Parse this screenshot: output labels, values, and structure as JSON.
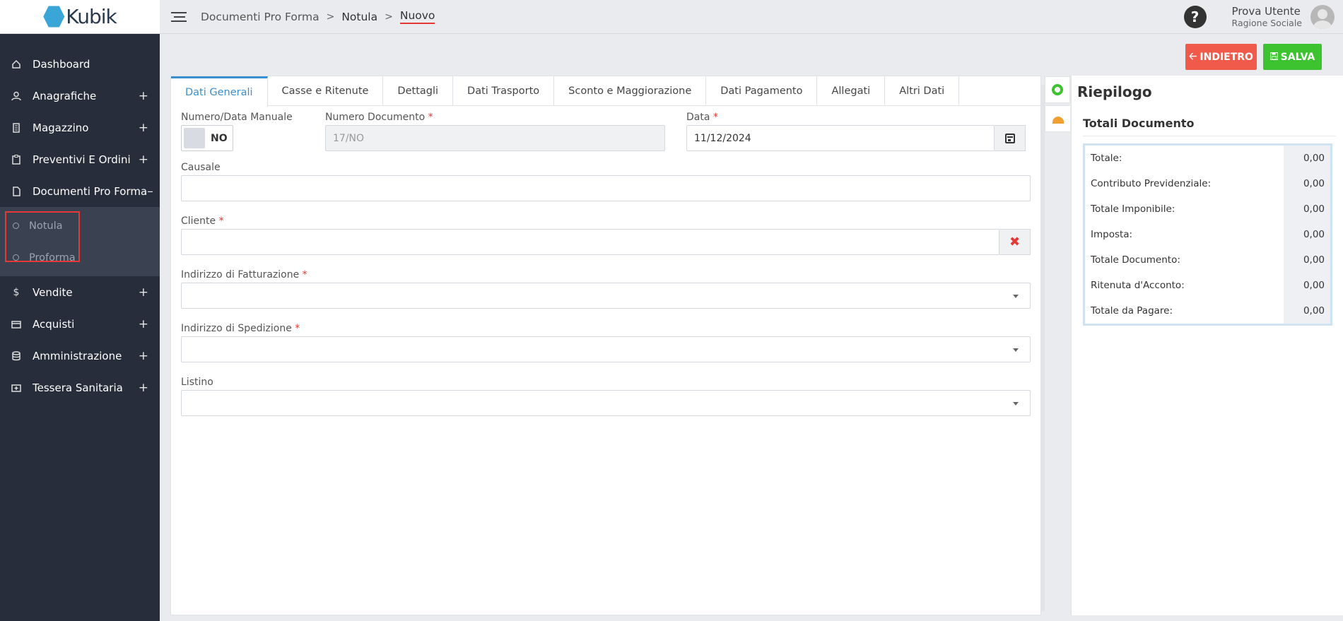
{
  "brand": {
    "name": "Kubik"
  },
  "sidebar": {
    "items": [
      {
        "label": "Dashboard",
        "icon": "home-icon",
        "expandable": false
      },
      {
        "label": "Anagrafiche",
        "icon": "user-icon",
        "expandable": true,
        "toggle": "+"
      },
      {
        "label": "Magazzino",
        "icon": "building-icon",
        "expandable": true,
        "toggle": "+"
      },
      {
        "label": "Preventivi E Ordini",
        "icon": "clipboard-icon",
        "expandable": true,
        "toggle": "+"
      },
      {
        "label": "Documenti Pro Forma",
        "icon": "document-icon",
        "expandable": true,
        "toggle": "–"
      }
    ],
    "subitems": [
      {
        "label": "Notula"
      },
      {
        "label": "Proforma"
      }
    ],
    "items_after": [
      {
        "label": "Vendite",
        "icon": "dollar-icon",
        "toggle": "+"
      },
      {
        "label": "Acquisti",
        "icon": "credit-card-icon",
        "toggle": "+"
      },
      {
        "label": "Amministrazione",
        "icon": "database-icon",
        "toggle": "+"
      },
      {
        "label": "Tessera Sanitaria",
        "icon": "medical-card-icon",
        "toggle": "+"
      }
    ]
  },
  "breadcrumb": {
    "level1": "Documenti Pro Forma",
    "level2": "Notula",
    "level3": "Nuovo",
    "sep": ">"
  },
  "user": {
    "name": "Prova Utente",
    "org": "Ragione Sociale",
    "help": "?"
  },
  "actions": {
    "back_label": "INDIETRO",
    "save_label": "SALVA",
    "back_color": "#f05a4a",
    "save_color": "#3cc32f"
  },
  "tabs": [
    "Dati Generali",
    "Casse e Ritenute",
    "Dettagli",
    "Dati Trasporto",
    "Sconto e Maggiorazione",
    "Dati Pagamento",
    "Allegati",
    "Altri Dati"
  ],
  "form": {
    "manual": {
      "label": "Numero/Data Manuale",
      "value": "NO"
    },
    "doc_number": {
      "label": "Numero Documento",
      "required": "*",
      "placeholder": "17/NO"
    },
    "date": {
      "label": "Data",
      "required": "*",
      "value": "11/12/2024"
    },
    "causale": {
      "label": "Causale",
      "value": ""
    },
    "cliente": {
      "label": "Cliente",
      "required": "*",
      "value": "",
      "clear": "✖"
    },
    "billing": {
      "label": "Indirizzo di Fatturazione",
      "required": "*",
      "value": ""
    },
    "shipping": {
      "label": "Indirizzo di Spedizione",
      "required": "*",
      "value": ""
    },
    "listino": {
      "label": "Listino",
      "value": ""
    }
  },
  "summary": {
    "title": "Riepilogo",
    "subtitle": "Totali Documento",
    "rows": [
      {
        "label": "Totale:",
        "value": "0,00"
      },
      {
        "label": "Contributo Previdenziale:",
        "value": "0,00"
      },
      {
        "label": "Totale Imponibile:",
        "value": "0,00"
      },
      {
        "label": "Imposta:",
        "value": "0,00"
      },
      {
        "label": "Totale Documento:",
        "value": "0,00"
      },
      {
        "label": "Ritenuta d'Acconto:",
        "value": "0,00"
      },
      {
        "label": "Totale da Pagare:",
        "value": "0,00"
      }
    ]
  }
}
